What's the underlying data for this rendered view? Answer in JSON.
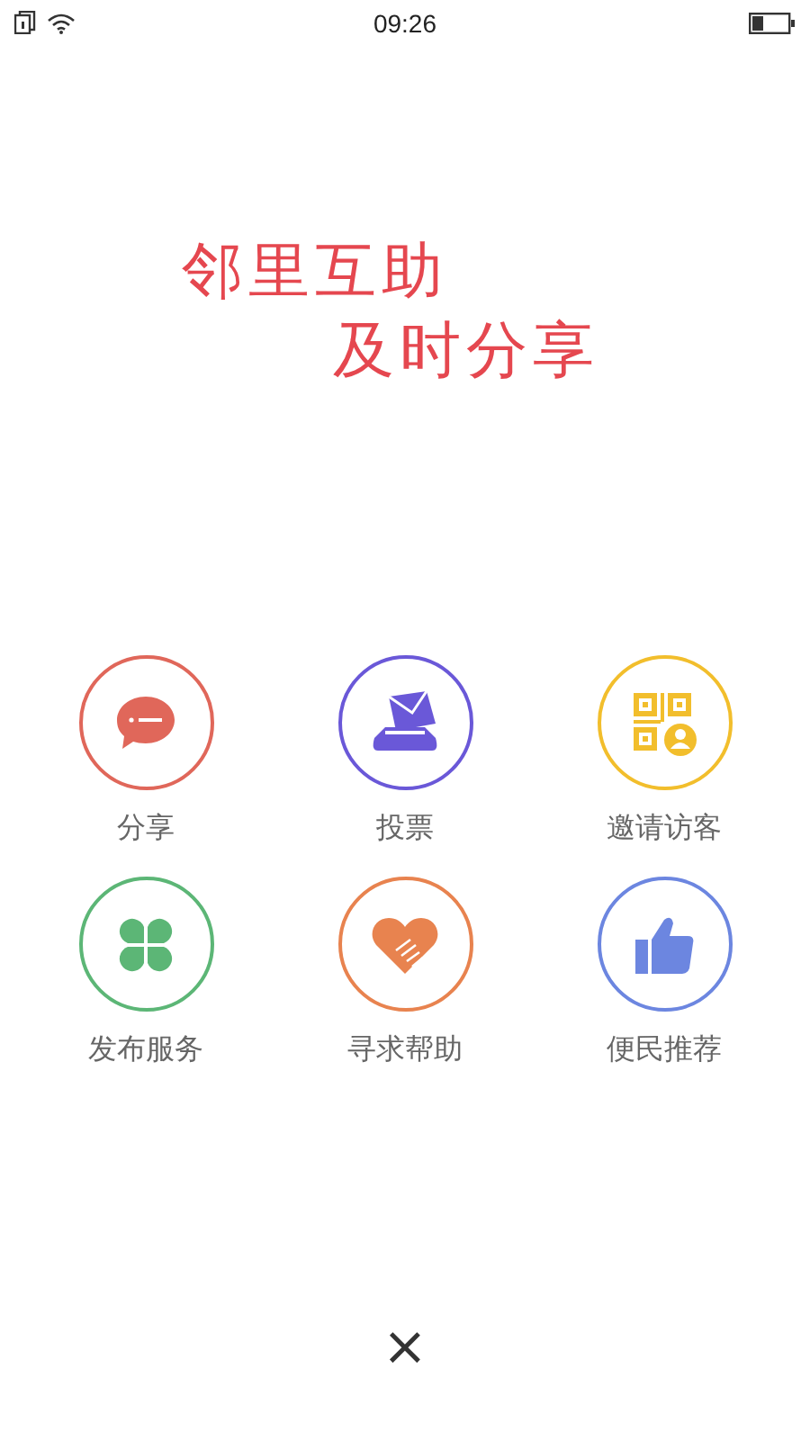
{
  "status_bar": {
    "time": "09:26"
  },
  "slogan": [
    "邻里互助",
    "及时分享"
  ],
  "actions": [
    {
      "label": "分享",
      "kind": "chat",
      "color": "#e0675a"
    },
    {
      "label": "投票",
      "kind": "vote",
      "color": "#6a58d8"
    },
    {
      "label": "邀请访客",
      "kind": "qr",
      "color": "#f2be2c"
    },
    {
      "label": "发布服务",
      "kind": "clover",
      "color": "#5cb676"
    },
    {
      "label": "寻求帮助",
      "kind": "heart",
      "color": "#e8834f"
    },
    {
      "label": "便民推荐",
      "kind": "thumb",
      "color": "#6c86e0"
    }
  ],
  "close": "×"
}
